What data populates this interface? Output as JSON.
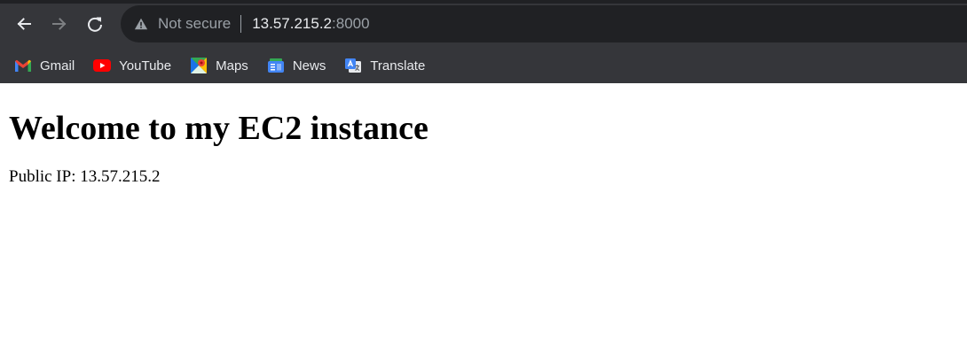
{
  "toolbar": {
    "back_icon": "arrow-left-icon",
    "forward_icon": "arrow-right-icon",
    "reload_icon": "reload-icon",
    "omnibox": {
      "security_icon": "warning-triangle-icon",
      "security_label": "Not secure",
      "host": "13.57.215.2",
      "port": ":8000"
    }
  },
  "bookmarks": [
    {
      "label": "Gmail",
      "icon": "gmail-icon"
    },
    {
      "label": "YouTube",
      "icon": "youtube-icon"
    },
    {
      "label": "Maps",
      "icon": "maps-icon"
    },
    {
      "label": "News",
      "icon": "news-icon"
    },
    {
      "label": "Translate",
      "icon": "translate-icon"
    }
  ],
  "page": {
    "heading": "Welcome to my EC2 instance",
    "public_ip_text": "Public IP: 13.57.215.2"
  },
  "colors": {
    "chrome_bg": "#35363a",
    "omnibox_bg": "#202124",
    "text_light": "#e8eaed",
    "text_muted": "#9aa0a6"
  }
}
